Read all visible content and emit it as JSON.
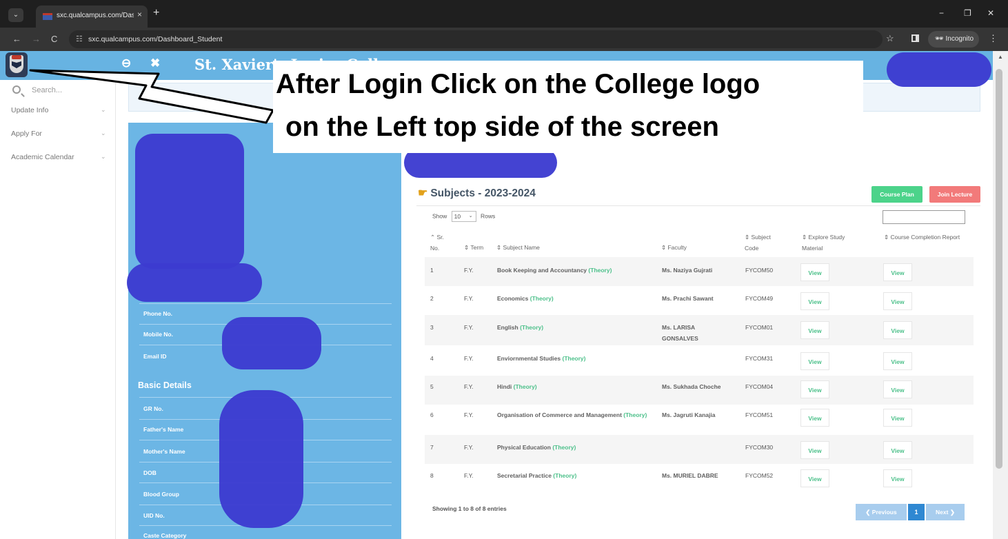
{
  "browser": {
    "tab_title": "sxc.qualcampus.com/Dashboar",
    "tab_close": "×",
    "new_tab": "+",
    "back": "←",
    "forward": "→",
    "reload": "C",
    "url": "sxc.qualcampus.com/Dashboard_Student",
    "incognito_label": "Incognito",
    "minimize": "−",
    "restore": "❐",
    "close": "✕"
  },
  "header": {
    "college_name": "St. Xavier's Junior College"
  },
  "sidebar": {
    "search_placeholder": "Search...",
    "items": [
      {
        "label": "Update Info"
      },
      {
        "label": "Apply For"
      },
      {
        "label": "Academic Calendar"
      }
    ]
  },
  "profile": {
    "fields_top": [
      {
        "label": "Phone No."
      },
      {
        "label": "Mobile No."
      },
      {
        "label": "Email ID"
      }
    ],
    "basic_title": "Basic Details",
    "fields_basic": [
      {
        "label": "GR No."
      },
      {
        "label": "Father's Name"
      },
      {
        "label": "Mother's Name"
      },
      {
        "label": "DOB"
      },
      {
        "label": "Blood Group"
      },
      {
        "label": "UID No."
      },
      {
        "label": "Caste Category"
      }
    ]
  },
  "subjects": {
    "title": "Subjects - 2023-2024",
    "course_plan_label": "Course Plan",
    "join_lecture_label": "Join Lecture",
    "show_label": "Show",
    "rows_label": "Rows",
    "page_size": "10",
    "columns": {
      "sr": "Sr. No.",
      "term": "Term",
      "name": "Subject Name",
      "faculty": "Faculty",
      "code": "Subject Code",
      "explore": "Explore Study Material",
      "report": "Course Completion Report"
    },
    "rows": [
      {
        "sr": "1",
        "term": "F.Y.",
        "name": "Book Keeping and Accountancy",
        "type": "(Theory)",
        "faculty": "Ms. Naziya Gujrati",
        "code": "FYCOM50",
        "explore": "View",
        "report": "View"
      },
      {
        "sr": "2",
        "term": "F.Y.",
        "name": "Economics",
        "type": "(Theory)",
        "faculty": "Ms. Prachi Sawant",
        "code": "FYCOM49",
        "explore": "View",
        "report": "View"
      },
      {
        "sr": "3",
        "term": "F.Y.",
        "name": "English",
        "type": "(Theory)",
        "faculty": "Ms. LARISA GONSALVES",
        "code": "FYCOM01",
        "explore": "View",
        "report": "View"
      },
      {
        "sr": "4",
        "term": "F.Y.",
        "name": "Enviornmental Studies",
        "type": "(Theory)",
        "faculty": "",
        "code": "FYCOM31",
        "explore": "View",
        "report": "View"
      },
      {
        "sr": "5",
        "term": "F.Y.",
        "name": "Hindi",
        "type": "(Theory)",
        "faculty": "Ms. Sukhada Choche",
        "code": "FYCOM04",
        "explore": "View",
        "report": "View"
      },
      {
        "sr": "6",
        "term": "F.Y.",
        "name": "Organisation of Commerce and Management",
        "type": "(Theory)",
        "faculty": "Ms. Jagruti Kanajia",
        "code": "FYCOM51",
        "explore": "View",
        "report": "View"
      },
      {
        "sr": "7",
        "term": "F.Y.",
        "name": "Physical Education",
        "type": "(Theory)",
        "faculty": "",
        "code": "FYCOM30",
        "explore": "View",
        "report": "View"
      },
      {
        "sr": "8",
        "term": "F.Y.",
        "name": "Secretarial Practice",
        "type": "(Theory)",
        "faculty": "Ms. MURIEL DABRE",
        "code": "FYCOM52",
        "explore": "View",
        "report": "View"
      }
    ],
    "showing_text": "Showing 1 to 8 of 8 entries",
    "prev_label": "❮ Previous",
    "current_page": "1",
    "next_label": "Next ❯"
  },
  "annotation": {
    "line1": "After Login Click on the College logo",
    "line2": "on the Left top side of the screen"
  },
  "colors": {
    "header_blue": "#67b3e2",
    "profile_blue": "#6cb6e5",
    "course_plan_green": "#4cd38a",
    "join_lecture_red": "#f27a7a",
    "theory_green": "#4cc08a",
    "scribble": "#3c3bd0"
  }
}
